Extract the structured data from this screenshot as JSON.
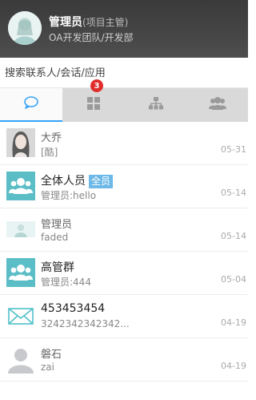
{
  "header": {
    "name": "管理员",
    "role": "(项目主管)",
    "dept": "OA开发团队/开发部"
  },
  "search": {
    "placeholder": "搜索联系人/会话/应用"
  },
  "tabs": [
    {
      "name": "chat-icon",
      "active": true
    },
    {
      "name": "apps-icon",
      "badge": "3"
    },
    {
      "name": "org-chart-icon"
    },
    {
      "name": "contacts-icon"
    }
  ],
  "conversations": [
    {
      "title": "大乔",
      "subtitle": "[酷]",
      "time": "05-31",
      "avatar": "photo-avatar"
    },
    {
      "title": "全体人员",
      "tag": "全员",
      "subtitle": "管理员:hello",
      "time": "05-14",
      "avatar": "group-icon"
    },
    {
      "title": "管理员",
      "subtitle": "faded",
      "time": "05-14",
      "avatar": "photo-avatar"
    },
    {
      "title": "高管群",
      "subtitle": "管理员:444",
      "time": "05-04",
      "avatar": "group-icon"
    },
    {
      "title": "453453454",
      "subtitle": "3242342342342...",
      "time": "04-19",
      "avatar": "mail-icon"
    },
    {
      "title": "磐石",
      "subtitle": "zai",
      "time": "04-19",
      "avatar": "person-icon"
    }
  ],
  "colors": {
    "accent": "#36a3f7",
    "badge": "#e12c2c",
    "group_icon": "#5bbdc6",
    "tag": "#6cb8e6"
  }
}
